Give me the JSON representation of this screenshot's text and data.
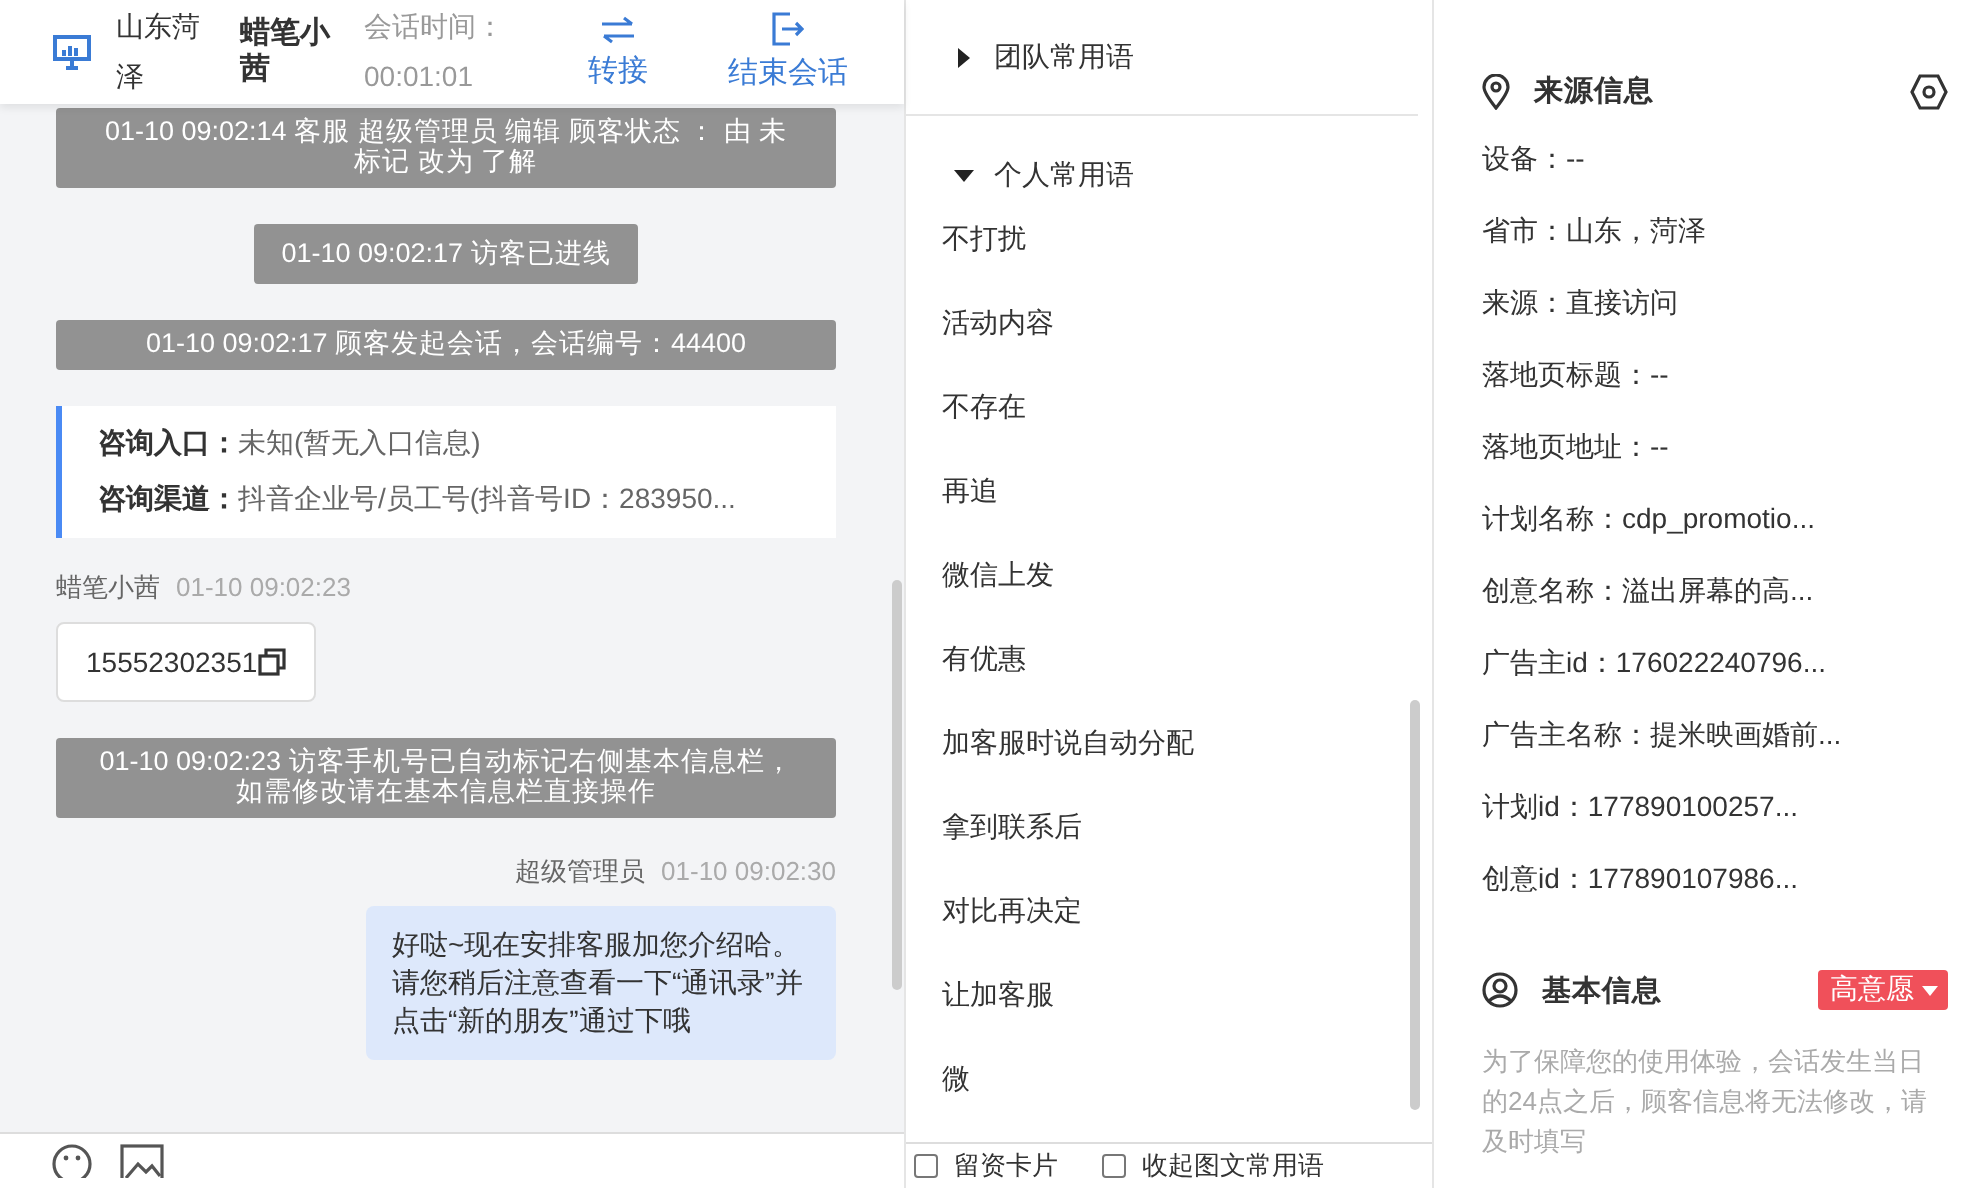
{
  "header": {
    "location": "山东菏泽",
    "visitor": "蜡笔小茜",
    "duration_label": "会话时间：",
    "duration": "00:01:01",
    "actions": [
      {
        "kind": "transfer",
        "label": "转接"
      },
      {
        "kind": "end",
        "label": "结束会话"
      }
    ]
  },
  "messages": [
    {
      "kind": "system",
      "text": "01-10 09:02:14 客服 超级管理员 编辑 顾客状态 ： 由 未标记 改为 了解"
    },
    {
      "kind": "system",
      "text": "01-10 09:02:17 访客已进线"
    },
    {
      "kind": "system",
      "text": "01-10 09:02:17 顾客发起会话，会话编号：44400"
    },
    {
      "kind": "entry",
      "rows": [
        {
          "label": "咨询入口：",
          "value": "未知(暂无入口信息)"
        },
        {
          "label": "咨询渠道：",
          "value": "抖音企业号/员工号(抖音号ID：283950..."
        }
      ]
    },
    {
      "kind": "visitor",
      "name": "蜡笔小茜",
      "time": "01-10 09:02:23",
      "text": "15552302351"
    },
    {
      "kind": "system",
      "text": "01-10 09:02:23 访客手机号已自动标记右侧基本信息栏，如需修改请在基本信息栏直接操作"
    },
    {
      "kind": "agent",
      "name": "超级管理员",
      "time": "01-10 09:02:30",
      "text": "好哒~现在安排客服加您介绍哈。请您稍后注意查看一下“通讯录”并点击“新的朋友”通过下哦"
    }
  ],
  "phrase_groups": [
    {
      "title": "团队常用语",
      "expanded": false
    },
    {
      "title": "个人常用语",
      "expanded": true,
      "items": [
        "不打扰",
        "活动内容",
        "不存在",
        "再追",
        "微信上发",
        "有优惠",
        "加客服时说自动分配",
        "拿到联系后",
        "对比再决定",
        "让加客服",
        "微"
      ]
    }
  ],
  "phrase_options": [
    {
      "label": "留资卡片",
      "checked": false
    },
    {
      "label": "收起图文常用语",
      "checked": false
    }
  ],
  "source_info": {
    "title": "来源信息",
    "fields": [
      "设备：--",
      "省市：山东，菏泽",
      "来源：直接访问",
      "落地页标题：--",
      "落地页地址：--",
      "计划名称：cdp_promotio...",
      "创意名称：溢出屏幕的高...",
      "广告主id：176022240796...",
      "广告主名称：提米映画婚前...",
      "计划id：177890100257...",
      "创意id：177890107986..."
    ]
  },
  "basic_info": {
    "title": "基本信息",
    "intent": "高意愿",
    "notice": "为了保障您的使用体验，会话发生当日的24点之后，顾客信息将无法修改，请及时填写"
  }
}
